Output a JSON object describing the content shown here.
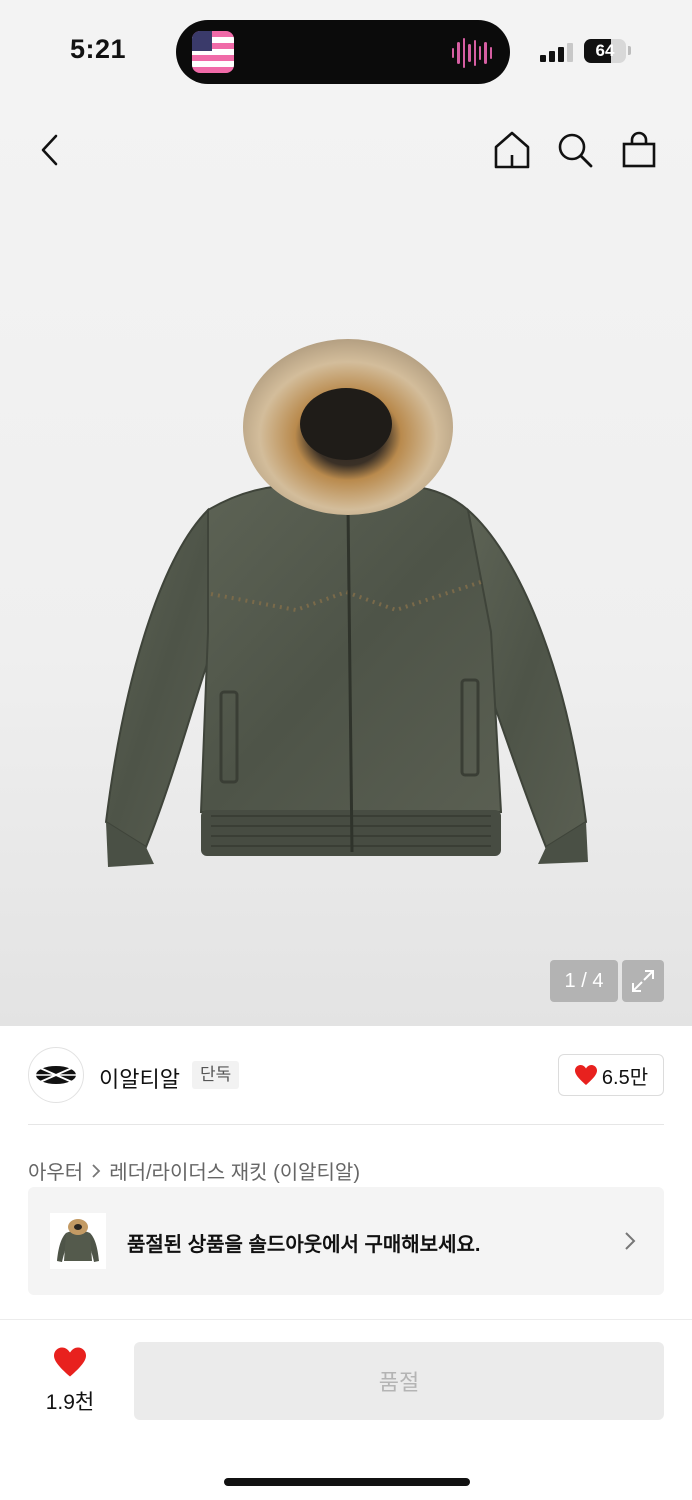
{
  "status_bar": {
    "time": "5:21",
    "battery_percent": "64",
    "battery_level": 0.64,
    "signal_bars": 3,
    "icons": [
      "music-flag-app-icon",
      "audio-wave-icon",
      "cellular-signal-icon",
      "battery-icon"
    ]
  },
  "header": {
    "icons": [
      "back-arrow-icon",
      "home-icon",
      "search-icon",
      "shopping-bag-icon"
    ]
  },
  "gallery": {
    "counter": "1 / 4",
    "current_image": 1,
    "total_images": 4,
    "image": "olive-green-bomber-jacket-with-fur-hood",
    "expand_icon": "expand-icon"
  },
  "brand": {
    "name": "이알티알",
    "exclusive_badge": "단독",
    "likes": "6.5만",
    "logo": "brand-logo-icon"
  },
  "breadcrumb": {
    "category": "아우터",
    "subcategory": "레더/라이더스 재킷 (이알티알)"
  },
  "soldout_banner": {
    "message": "품절된 상품을 솔드아웃에서 구매해보세요."
  },
  "bottom_bar": {
    "wishlist_count": "1.9천",
    "buy_button_label": "품절"
  },
  "colors": {
    "heart_red": "#e8211e",
    "disabled_button_bg": "#ebebeb",
    "disabled_button_text": "#b4b4b4",
    "jacket_olive": "#545a4c",
    "fur": "#c8ad86"
  }
}
